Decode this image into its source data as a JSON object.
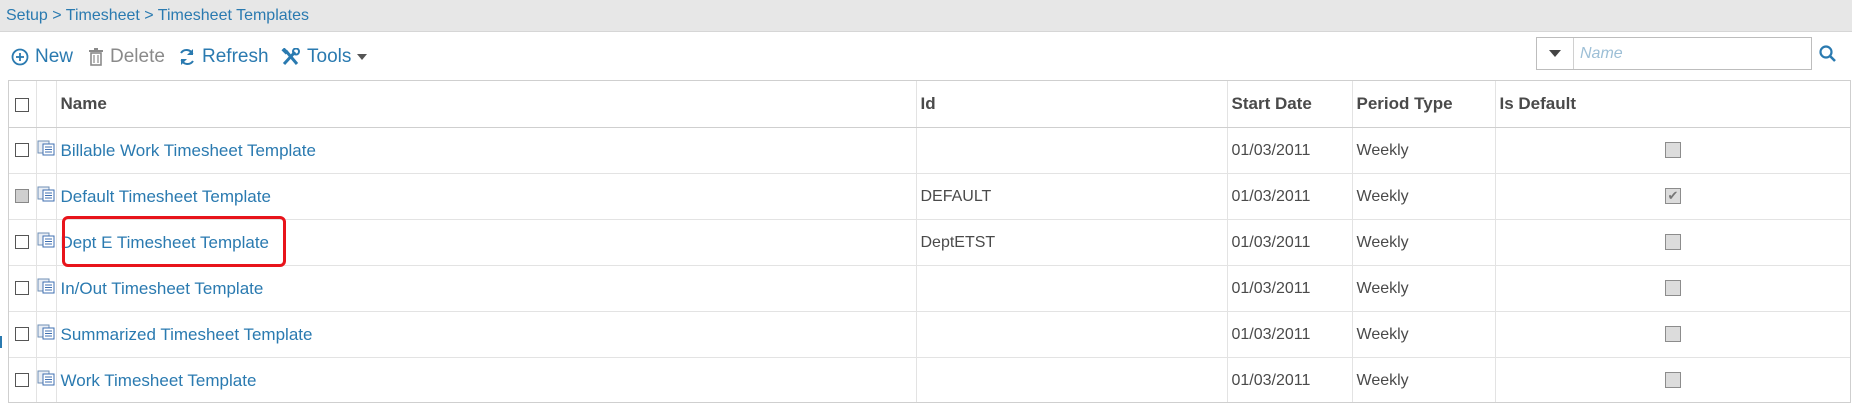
{
  "breadcrumb": {
    "text": "Setup > Timesheet > Timesheet Templates"
  },
  "toolbar": {
    "new_label": "New",
    "delete_label": "Delete",
    "refresh_label": "Refresh",
    "tools_label": "Tools"
  },
  "search": {
    "placeholder": "Name",
    "value": ""
  },
  "columns": {
    "name": "Name",
    "id": "Id",
    "start_date": "Start Date",
    "period_type": "Period Type",
    "is_default": "Is Default"
  },
  "rows": [
    {
      "name": "Billable Work Timesheet Template",
      "id": "",
      "start_date": "01/03/2011",
      "period_type": "Weekly",
      "is_default": false,
      "row_selectable": true
    },
    {
      "name": "Default Timesheet Template",
      "id": "DEFAULT",
      "start_date": "01/03/2011",
      "period_type": "Weekly",
      "is_default": true,
      "row_selectable": false
    },
    {
      "name": "Dept E Timesheet Template",
      "id": "DeptETST",
      "start_date": "01/03/2011",
      "period_type": "Weekly",
      "is_default": false,
      "row_selectable": true
    },
    {
      "name": "In/Out Timesheet Template",
      "id": "",
      "start_date": "01/03/2011",
      "period_type": "Weekly",
      "is_default": false,
      "row_selectable": true
    },
    {
      "name": "Summarized Timesheet Template",
      "id": "",
      "start_date": "01/03/2011",
      "period_type": "Weekly",
      "is_default": false,
      "row_selectable": true
    },
    {
      "name": "Work Timesheet Template",
      "id": "",
      "start_date": "01/03/2011",
      "period_type": "Weekly",
      "is_default": false,
      "row_selectable": true
    }
  ],
  "colors": {
    "link": "#2a7ab0",
    "highlight": "#e8141b",
    "header_bg": "#e7e7e7"
  },
  "icons": [
    "plus-circle-icon",
    "trash-icon",
    "refresh-icon",
    "tools-icon",
    "caret-down-icon",
    "search-icon",
    "template-icon"
  ]
}
